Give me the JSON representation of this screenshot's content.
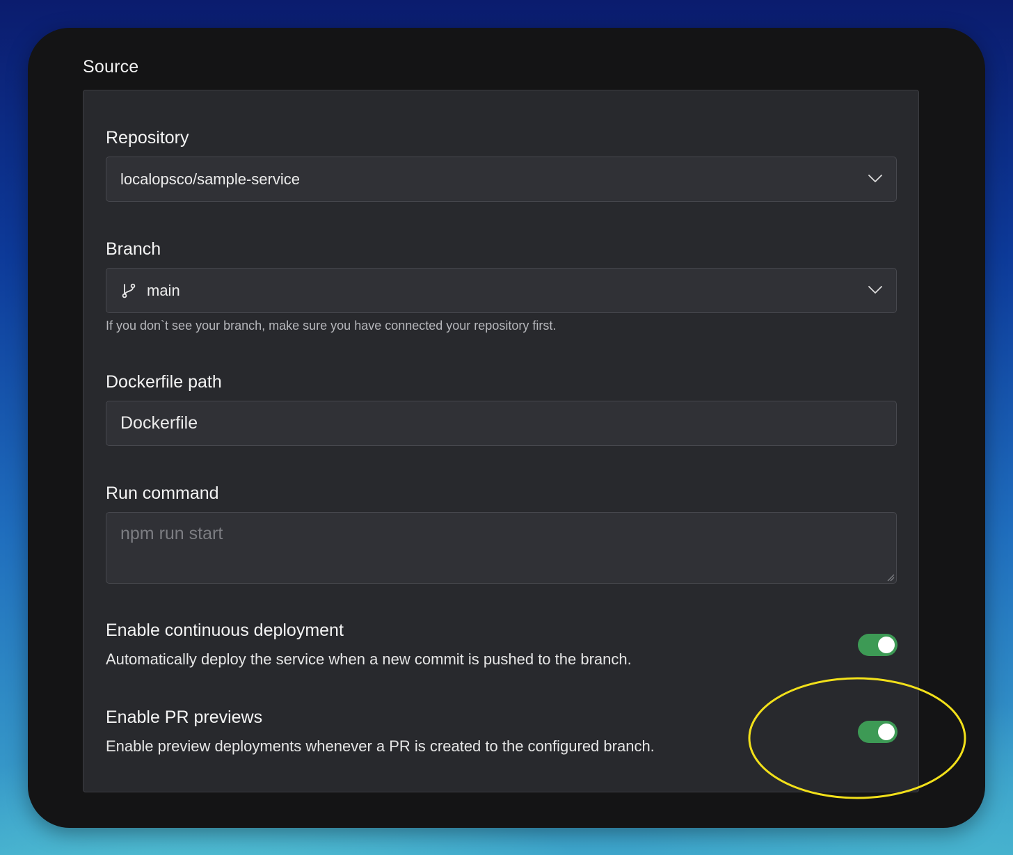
{
  "section": {
    "title": "Source"
  },
  "repository": {
    "label": "Repository",
    "value": "localopsco/sample-service",
    "icon": "chevron-down-icon"
  },
  "branch": {
    "label": "Branch",
    "value": "main",
    "icon": "git-branch-icon",
    "help": "If you don`t see your branch, make sure you have connected your repository first."
  },
  "dockerfile": {
    "label": "Dockerfile path",
    "value": "Dockerfile"
  },
  "run_command": {
    "label": "Run command",
    "placeholder": "npm run start",
    "value": ""
  },
  "continuous_deployment": {
    "title": "Enable continuous deployment",
    "description": "Automatically deploy the service when a new commit is pushed to the branch.",
    "enabled": true
  },
  "pr_previews": {
    "title": "Enable PR previews",
    "description": "Enable preview deployments whenever a PR is created to the configured branch.",
    "enabled": true
  },
  "colors": {
    "toggle_on": "#3d9a55",
    "highlight_annotation": "#f2e01a",
    "panel_bg": "#28292d"
  }
}
